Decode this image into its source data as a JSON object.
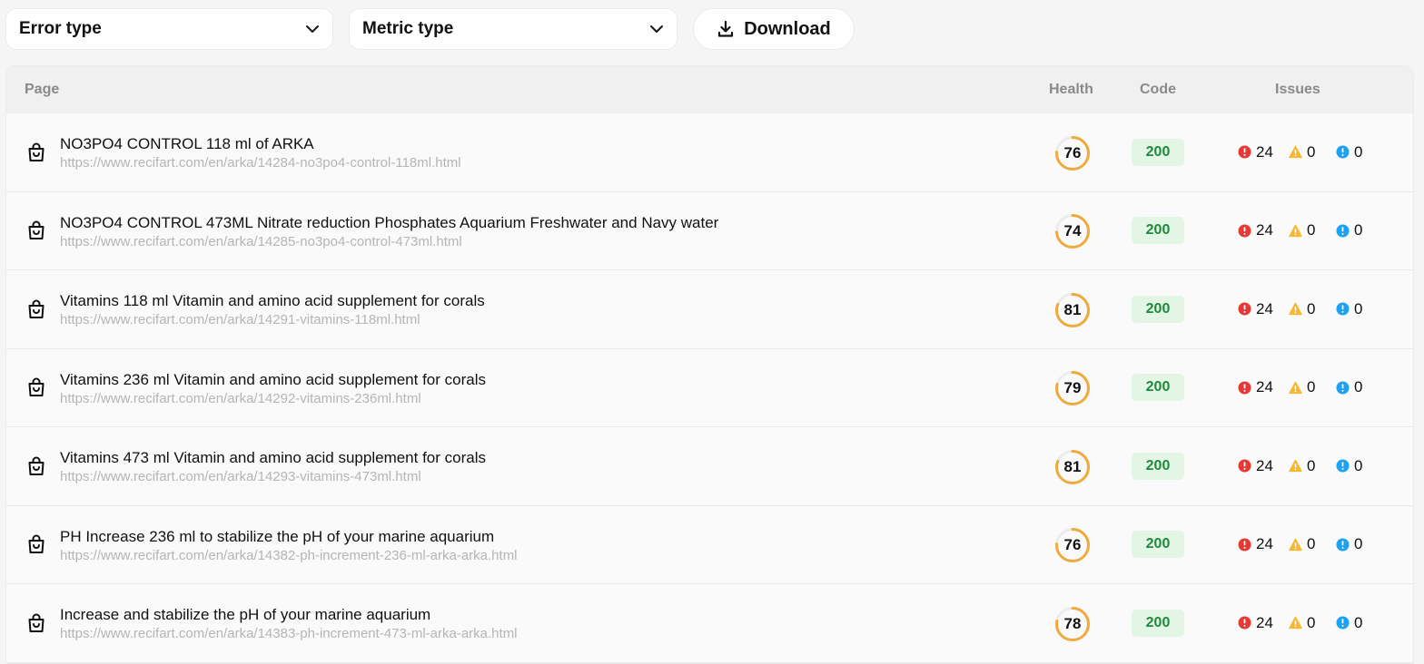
{
  "toolbar": {
    "error_type_label": "Error type",
    "metric_type_label": "Metric type",
    "download_label": "Download"
  },
  "table": {
    "headers": {
      "page": "Page",
      "health": "Health",
      "code": "Code",
      "issues": "Issues"
    },
    "rows": [
      {
        "title": "NO3PO4 CONTROL 118 ml of ARKA",
        "url": "https://www.recifart.com/en/arka/14284-no3po4-control-118ml.html",
        "health": 76,
        "code": "200",
        "errors": "24",
        "warnings": "0",
        "notices": "0"
      },
      {
        "title": "NO3PO4 CONTROL 473ML Nitrate reduction Phosphates Aquarium Freshwater and Navy water",
        "url": "https://www.recifart.com/en/arka/14285-no3po4-control-473ml.html",
        "health": 74,
        "code": "200",
        "errors": "24",
        "warnings": "0",
        "notices": "0"
      },
      {
        "title": "Vitamins 118 ml Vitamin and amino acid supplement for corals",
        "url": "https://www.recifart.com/en/arka/14291-vitamins-118ml.html",
        "health": 81,
        "code": "200",
        "errors": "24",
        "warnings": "0",
        "notices": "0"
      },
      {
        "title": "Vitamins 236 ml Vitamin and amino acid supplement for corals",
        "url": "https://www.recifart.com/en/arka/14292-vitamins-236ml.html",
        "health": 79,
        "code": "200",
        "errors": "24",
        "warnings": "0",
        "notices": "0"
      },
      {
        "title": "Vitamins 473 ml Vitamin and amino acid supplement for corals",
        "url": "https://www.recifart.com/en/arka/14293-vitamins-473ml.html",
        "health": 81,
        "code": "200",
        "errors": "24",
        "warnings": "0",
        "notices": "0"
      },
      {
        "title": "PH Increase 236 ml to stabilize the pH of your marine aquarium",
        "url": "https://www.recifart.com/en/arka/14382-ph-increment-236-ml-arka-arka.html",
        "health": 76,
        "code": "200",
        "errors": "24",
        "warnings": "0",
        "notices": "0"
      },
      {
        "title": "Increase and stabilize the pH of your marine aquarium",
        "url": "https://www.recifart.com/en/arka/14383-ph-increment-473-ml-arka-arka.html",
        "health": 78,
        "code": "200",
        "errors": "24",
        "warnings": "0",
        "notices": "0"
      }
    ]
  },
  "colors": {
    "health_ring": "#f0a93b",
    "health_track": "#ececec",
    "code_bg": "#e3f6e6",
    "code_text": "#1f8a3a",
    "error": "#e53935",
    "warning": "#f5b82e",
    "notice": "#1da1f2"
  },
  "icons": {
    "row": "shopping-bag-icon",
    "dropdown": "chevron-down-icon",
    "download": "download-icon",
    "error": "error-circle-icon",
    "warning": "warning-triangle-icon",
    "notice": "info-circle-icon"
  }
}
